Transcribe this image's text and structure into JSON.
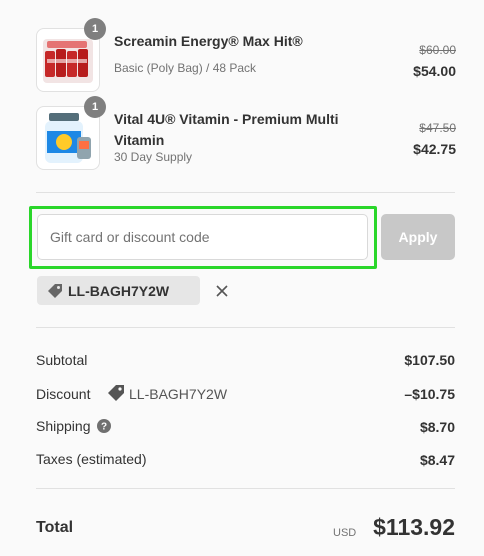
{
  "products": [
    {
      "quantity": "1",
      "name": "Screamin Energy® Max Hit®",
      "variant": "Basic (Poly Bag) / 48 Pack",
      "compare_price": "$60.00",
      "price": "$54.00"
    },
    {
      "quantity": "1",
      "name": "Vital 4U® Vitamin - Premium Multi Vitamin",
      "variant": "30 Day Supply",
      "compare_price": "$47.50",
      "price": "$42.75"
    }
  ],
  "discount_form": {
    "placeholder": "Gift card or discount code",
    "value": "",
    "apply_label": "Apply",
    "focus_color": "#2ad62a"
  },
  "applied_code": {
    "code": "LL-BAGH7Y2W",
    "icon": "tag-icon",
    "remove_icon": "close-icon"
  },
  "summary": {
    "subtotal_label": "Subtotal",
    "subtotal_value": "$107.50",
    "discount_label": "Discount",
    "discount_code": "LL-BAGH7Y2W",
    "discount_value": "–$10.75",
    "shipping_label": "Shipping",
    "shipping_help_icon": "question-circle-icon",
    "shipping_value": "$8.70",
    "taxes_label": "Taxes (estimated)",
    "taxes_value": "$8.47"
  },
  "total": {
    "label": "Total",
    "currency": "USD",
    "value": "$113.92"
  }
}
